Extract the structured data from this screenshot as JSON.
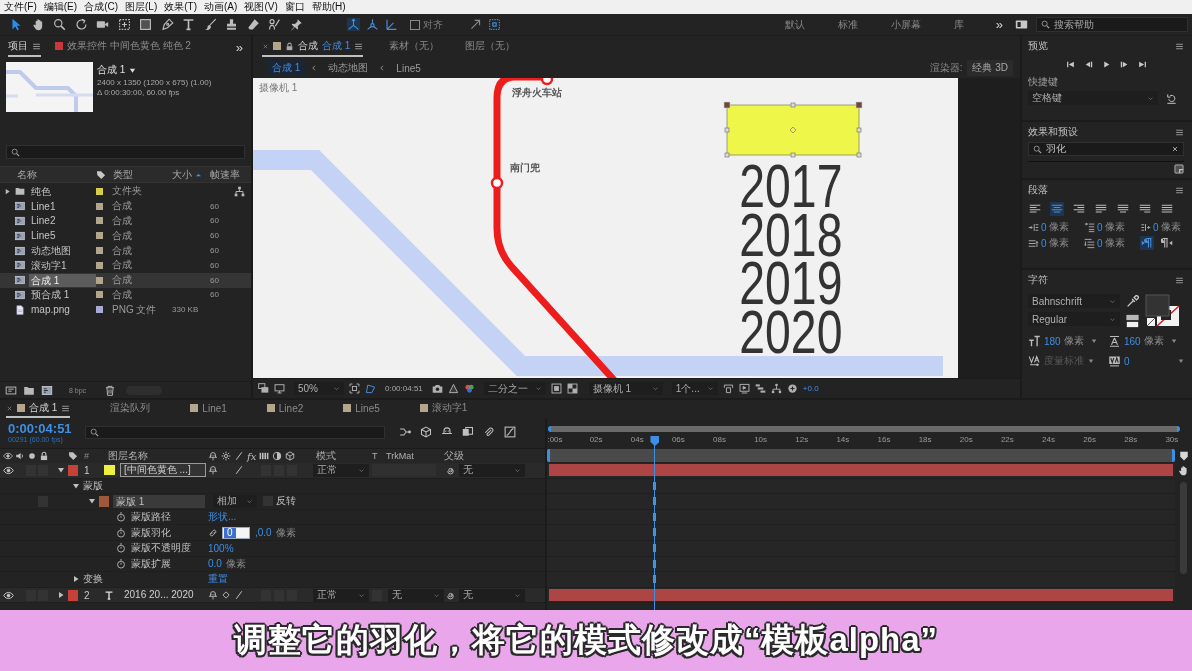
{
  "menu": [
    "文件(F)",
    "编辑(E)",
    "合成(C)",
    "图层(L)",
    "效果(T)",
    "动画(A)",
    "视图(V)",
    "窗口",
    "帮助(H)"
  ],
  "toolbar": {
    "tools": [
      {
        "kind": "select",
        "selected": true
      },
      {
        "kind": "hand",
        "selected": false
      },
      {
        "kind": "zoom",
        "selected": false
      },
      {
        "kind": "rotate",
        "selected": false
      },
      {
        "kind": "camera",
        "selected": false
      },
      {
        "kind": "pan",
        "selected": false
      },
      {
        "kind": "rect",
        "selected": false
      },
      {
        "kind": "pen",
        "selected": false
      },
      {
        "kind": "type",
        "selected": false
      },
      {
        "kind": "brush",
        "selected": false
      },
      {
        "kind": "stamp",
        "selected": false
      },
      {
        "kind": "eraser",
        "selected": false
      },
      {
        "kind": "roto",
        "selected": false
      },
      {
        "kind": "pin",
        "selected": false
      }
    ],
    "axis_tools": [
      {
        "kind": "local",
        "selected": true
      },
      {
        "kind": "world",
        "selected": false
      },
      {
        "kind": "view",
        "selected": false
      }
    ],
    "snap": {
      "label": "对齐",
      "checked": false
    },
    "workspaces": [
      {
        "label": "默认",
        "selected": false
      },
      {
        "label": "标准",
        "selected": false
      },
      {
        "label": "小屏幕",
        "selected": false
      },
      {
        "label": "库",
        "selected": false
      }
    ],
    "overflow": "»",
    "search_placeholder": "搜索帮助"
  },
  "project_panel": {
    "tabs": [
      {
        "label": "项目",
        "selected": true
      },
      {
        "label": "效果控件 中间色黄色 纯色 2",
        "color": "#c8383a",
        "selected": false
      }
    ],
    "overflow": "»",
    "comp": {
      "name": "合成 1",
      "size": "2400 x 1350  (1200 x 675) (1.00)",
      "duration": "Δ 0:00:30:00, 60.00 fps"
    },
    "columns": [
      "名称",
      "类型",
      "大小",
      "帧速率"
    ],
    "items": [
      {
        "kind": "folder",
        "name": "纯色",
        "color": "#d9cd4c",
        "type": "文件夹",
        "expanded": false,
        "selected": false
      },
      {
        "kind": "comp",
        "name": "Line1",
        "color": "#b3a68c",
        "type": "合成",
        "fps": "60",
        "selected": false
      },
      {
        "kind": "comp",
        "name": "Line2",
        "color": "#b3a68c",
        "type": "合成",
        "fps": "60",
        "selected": false
      },
      {
        "kind": "comp",
        "name": "Line5",
        "color": "#b3a68c",
        "type": "合成",
        "fps": "60",
        "selected": false
      },
      {
        "kind": "comp",
        "name": "动态地图",
        "color": "#b3a68c",
        "type": "合成",
        "fps": "60",
        "selected": false
      },
      {
        "kind": "comp",
        "name": "滚动字1",
        "color": "#b3a68c",
        "type": "合成",
        "fps": "60",
        "selected": false
      },
      {
        "kind": "comp",
        "name": "合成 1",
        "color": "#b3a68c",
        "type": "合成",
        "fps": "60",
        "selected": true
      },
      {
        "kind": "comp",
        "name": "预合成 1",
        "color": "#b3a68c",
        "type": "合成",
        "fps": "60",
        "selected": false
      },
      {
        "kind": "file",
        "name": "map.png",
        "color": "#aaaad6",
        "type": "PNG 文件",
        "size": "330 KB",
        "selected": false
      }
    ],
    "bit_depth": "8 bpc"
  },
  "comp_panel": {
    "tabs": [
      {
        "label": "合成",
        "target": "合成 1",
        "color": "#b3a68c",
        "selected": true
      },
      {
        "label": "素材（无）",
        "selected": false
      },
      {
        "label": "图层（无）",
        "selected": false
      }
    ],
    "breadcrumbs": [
      {
        "label": "合成 1",
        "selected": true
      },
      {
        "label": "动态地图",
        "selected": false
      },
      {
        "label": "Line5",
        "selected": false
      }
    ],
    "renderer": {
      "label": "渲染器:",
      "value": "经典 3D"
    },
    "viewer": {
      "camera_label": "摄像机 1",
      "stations": [
        "浮舟火车站",
        "南门兜"
      ],
      "years": [
        "2017",
        "2018",
        "2019",
        "2020"
      ]
    },
    "footer": {
      "zoom": "50%",
      "timecode": "0:00:04:51",
      "resolution": "二分之一",
      "camera": "摄像机 1",
      "views": "1个...",
      "exposure": "+0.0"
    }
  },
  "preview_panel": {
    "title": "预览",
    "shortcut_label": "快捷键",
    "shortcut": "空格键"
  },
  "effects_panel": {
    "title": "效果和预设",
    "search": "羽化"
  },
  "paragraph_panel": {
    "title": "段落",
    "align": [
      {
        "kind": "left",
        "selected": false
      },
      {
        "kind": "center",
        "selected": true
      },
      {
        "kind": "right",
        "selected": false
      },
      {
        "kind": "justify-left",
        "selected": false
      },
      {
        "kind": "justify-center",
        "selected": false
      },
      {
        "kind": "justify-right",
        "selected": false
      },
      {
        "kind": "justify-all",
        "selected": false
      }
    ],
    "indents": [
      {
        "value": "0",
        "unit": "像素"
      },
      {
        "value": "0",
        "unit": "像素"
      },
      {
        "value": "0",
        "unit": "像素"
      },
      {
        "value": "0",
        "unit": "像素"
      },
      {
        "value": "0",
        "unit": "像素"
      }
    ],
    "direction": [
      {
        "kind": "ltr",
        "selected": true
      },
      {
        "kind": "rtl",
        "selected": false
      }
    ]
  },
  "character_panel": {
    "title": "字符",
    "font": "Bahnschrift",
    "style": "Regular",
    "size": {
      "value": "180",
      "unit": "像素"
    },
    "leading": {
      "value": "160",
      "unit": "像素"
    },
    "kerning": {
      "value": "度量标准",
      "disabled": true
    },
    "tracking": "0"
  },
  "timeline": {
    "tabs": [
      {
        "label": "合成 1",
        "color": "#b3a68c",
        "selected": true
      },
      {
        "label": "渲染队列",
        "selected": false
      },
      {
        "label": "Line1",
        "color": "#b3a68c",
        "selected": false
      },
      {
        "label": "Line2",
        "color": "#b3a68c",
        "selected": false
      },
      {
        "label": "Line5",
        "color": "#b3a68c",
        "selected": false
      },
      {
        "label": "滚动字1",
        "color": "#b3a68c",
        "selected": false
      }
    ],
    "timecode": "0:00:04:51",
    "frame_info": "00291 (60.00 fps)",
    "ruler": [
      ":00s",
      "02s",
      "04s",
      "06s",
      "08s",
      "10s",
      "12s",
      "14s",
      "16s",
      "18s",
      "20s",
      "22s",
      "24s",
      "26s",
      "28s",
      "30s"
    ],
    "playhead": {
      "level": 0.162
    },
    "columns": {
      "number": "#",
      "name": "图层名称",
      "fx": "fx",
      "mode": "模式",
      "transparency": "T",
      "trkmat": "TrkMat",
      "parent": "父级"
    },
    "rows": [
      {
        "kind": "layer",
        "number": "1",
        "color": "#c8403a",
        "source": {
          "kind": "solid",
          "color": "#eef040"
        },
        "name": "[中间色黄色 ...]",
        "visible": true,
        "expanded": true,
        "selected": true,
        "mode": "正常",
        "parent": "无"
      },
      {
        "kind": "group",
        "name": "蒙版",
        "expanded": true
      },
      {
        "kind": "mask",
        "name": "蒙版 1",
        "color": "#a0583a",
        "expanded": true,
        "mode": "相加",
        "invert_label": "反转",
        "inverted": false
      },
      {
        "kind": "property",
        "name": "蒙版路径",
        "value": "形状..."
      },
      {
        "kind": "property",
        "name": "蒙版羽化",
        "linked": true,
        "editing": true,
        "value": "0",
        "value2": ",0.0",
        "unit": "像素"
      },
      {
        "kind": "property",
        "name": "蒙版不透明度",
        "value": "100%"
      },
      {
        "kind": "property",
        "name": "蒙版扩展",
        "value": "0.0",
        "unit": "像素"
      },
      {
        "kind": "group",
        "name": "变换",
        "expanded": false,
        "value": "重置"
      },
      {
        "kind": "layer",
        "number": "2",
        "color": "#c8403a",
        "source": {
          "kind": "text"
        },
        "name": "2016 20... 2020",
        "visible": true,
        "expanded": false,
        "selected": false,
        "mode": "正常",
        "trkmat": "无",
        "parent": "无"
      }
    ]
  },
  "subtitle": "调整它的羽化，将它的模式修改成“模板alpha”"
}
